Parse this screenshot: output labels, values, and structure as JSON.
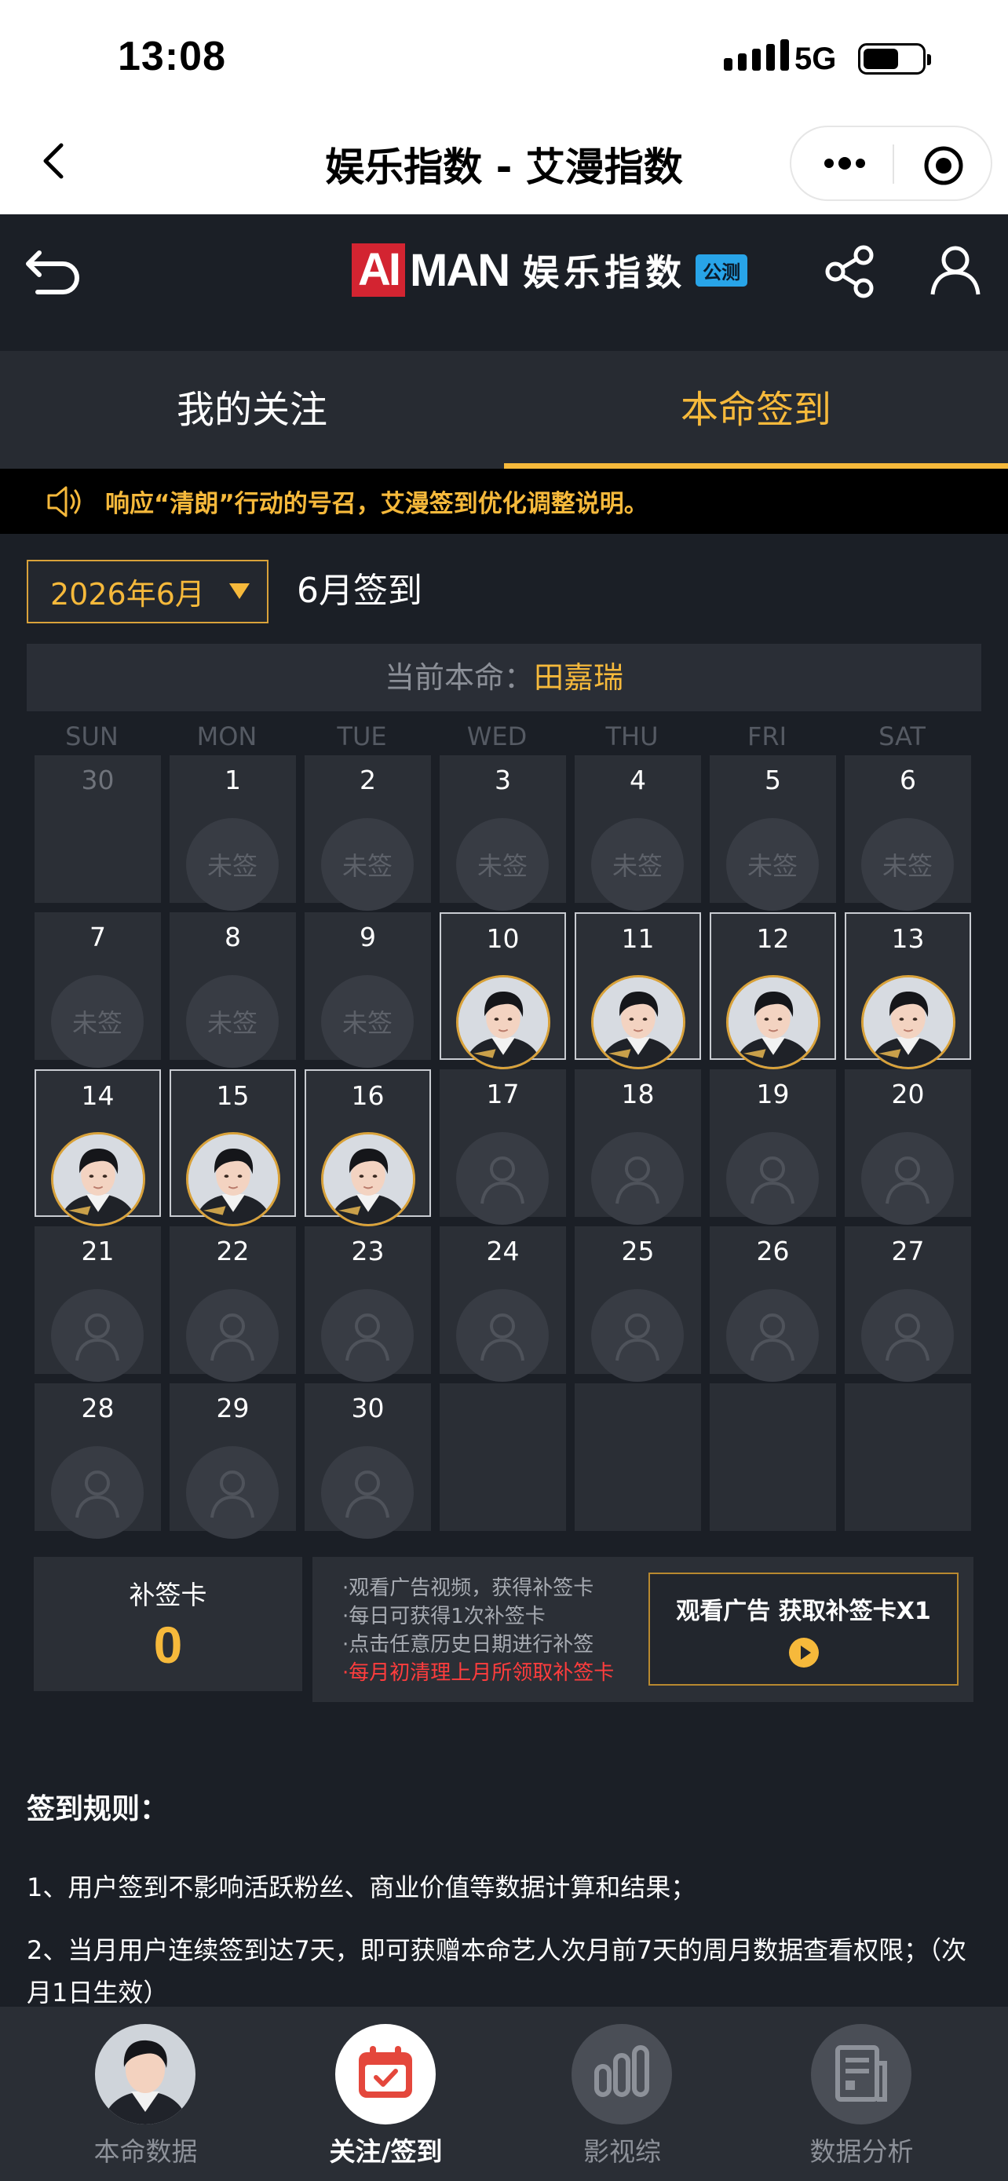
{
  "status_bar": {
    "time": "13:08",
    "network": "5G"
  },
  "nav": {
    "title": "娱乐指数 - 艾漫指数"
  },
  "header": {
    "logo_ai": "AI",
    "logo_man": "MAN",
    "logo_cn": "娱乐指数",
    "beta_badge": "公测"
  },
  "tabs": [
    {
      "label": "我的关注",
      "active": false
    },
    {
      "label": "本命签到",
      "active": true
    }
  ],
  "notice": {
    "text": "响应“清朗”行动的号召，艾漫签到优化调整说明。"
  },
  "month_select": {
    "value": "2026年6月"
  },
  "calendar_title": "6月签到",
  "current": {
    "label": "当前本命：",
    "value": "田嘉瑞"
  },
  "weekdays": [
    "SUN",
    "MON",
    "TUE",
    "WED",
    "THU",
    "FRI",
    "SAT"
  ],
  "unsigned_label": "未签",
  "calendar": {
    "days": [
      {
        "n": "30",
        "status": "prev"
      },
      {
        "n": "1",
        "status": "unsigned"
      },
      {
        "n": "2",
        "status": "unsigned"
      },
      {
        "n": "3",
        "status": "unsigned"
      },
      {
        "n": "4",
        "status": "unsigned"
      },
      {
        "n": "5",
        "status": "unsigned"
      },
      {
        "n": "6",
        "status": "unsigned"
      },
      {
        "n": "7",
        "status": "unsigned"
      },
      {
        "n": "8",
        "status": "unsigned"
      },
      {
        "n": "9",
        "status": "unsigned"
      },
      {
        "n": "10",
        "status": "signed"
      },
      {
        "n": "11",
        "status": "signed"
      },
      {
        "n": "12",
        "status": "signed"
      },
      {
        "n": "13",
        "status": "signed"
      },
      {
        "n": "14",
        "status": "signed"
      },
      {
        "n": "15",
        "status": "signed"
      },
      {
        "n": "16",
        "status": "signed"
      },
      {
        "n": "17",
        "status": "future"
      },
      {
        "n": "18",
        "status": "future"
      },
      {
        "n": "19",
        "status": "future"
      },
      {
        "n": "20",
        "status": "future"
      },
      {
        "n": "21",
        "status": "future"
      },
      {
        "n": "22",
        "status": "future"
      },
      {
        "n": "23",
        "status": "future"
      },
      {
        "n": "24",
        "status": "future"
      },
      {
        "n": "25",
        "status": "future"
      },
      {
        "n": "26",
        "status": "future"
      },
      {
        "n": "27",
        "status": "future"
      },
      {
        "n": "28",
        "status": "future"
      },
      {
        "n": "29",
        "status": "future"
      },
      {
        "n": "30",
        "status": "future"
      },
      {
        "n": "",
        "status": "empty"
      },
      {
        "n": "",
        "status": "empty"
      },
      {
        "n": "",
        "status": "empty"
      },
      {
        "n": "",
        "status": "empty"
      }
    ]
  },
  "makeup_card": {
    "title": "补签卡",
    "count": "0"
  },
  "makeup_info": {
    "lines": [
      "·观看广告视频，获得补签卡",
      "·每日可获得1次补签卡",
      "·点击任意历史日期进行补签"
    ],
    "warning": "·每月初清理上月所领取补签卡"
  },
  "ad_button": {
    "label": "观看广告 获取补签卡X1"
  },
  "rules": {
    "title": "签到规则：",
    "items": [
      "1、用户签到不影响活跃粉丝、商业价值等数据计算和结果；",
      "2、当月用户连续签到达7天，即可获赠本命艺人次月前7天的周月数据查看权限；（次月1日生效）"
    ]
  },
  "tabbar": [
    {
      "label": "本命数据",
      "icon": "avatar-icon",
      "active": false
    },
    {
      "label": "关注/签到",
      "icon": "calendar-check-icon",
      "active": true
    },
    {
      "label": "影视综",
      "icon": "bars-icon",
      "active": false
    },
    {
      "label": "数据分析",
      "icon": "document-icon",
      "active": false
    }
  ],
  "colors": {
    "accent": "#f6b93b",
    "background": "#1b1f26",
    "warning": "#ff3d3d"
  }
}
